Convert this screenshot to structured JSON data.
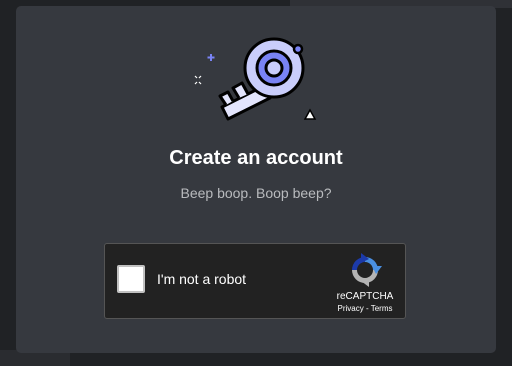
{
  "modal": {
    "title": "Create an account",
    "subtitle": "Beep boop. Boop beep?"
  },
  "captcha": {
    "checkbox_label": "I'm not a robot",
    "brand": "reCAPTCHA",
    "privacy_label": "Privacy",
    "separator": " - ",
    "terms_label": "Terms"
  },
  "colors": {
    "background": "#202225",
    "modal": "#36393f",
    "key_fill": "#c9cdfb",
    "key_accent": "#7983f5",
    "sparkle": "#7983f5"
  },
  "icons": [
    "key-illustration",
    "sparkle-icon",
    "triangle-icon",
    "recaptcha-logo-icon"
  ]
}
